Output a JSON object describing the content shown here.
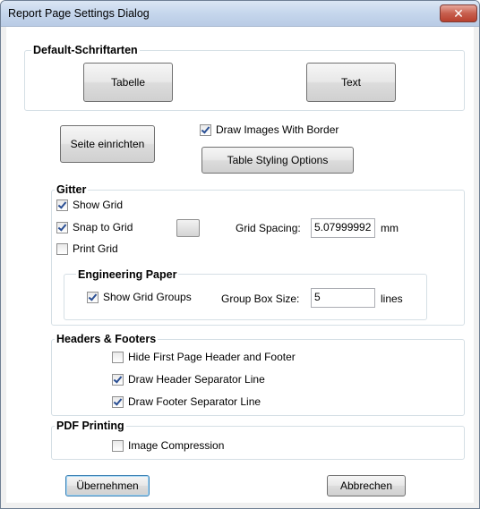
{
  "window": {
    "title": "Report Page Settings Dialog",
    "close_glyph": "✕"
  },
  "default_fonts": {
    "title": "Default-Schriftarten",
    "table_label": "Tabelle",
    "text_label": "Text"
  },
  "page_setup_label": "Seite einrichten",
  "draw_images_border": {
    "label": "Draw Images With Border",
    "checked": true
  },
  "table_styling_label": "Table Styling Options",
  "grid": {
    "title": "Gitter",
    "show_grid": {
      "label": "Show Grid",
      "checked": true
    },
    "snap_to_grid": {
      "label": "Snap to Grid",
      "checked": true
    },
    "print_grid": {
      "label": "Print Grid",
      "checked": false
    },
    "spacing_label": "Grid Spacing:",
    "spacing_value": "5.07999992",
    "spacing_unit": "mm"
  },
  "engineering_paper": {
    "title": "Engineering Paper",
    "show_groups": {
      "label": "Show Grid Groups",
      "checked": true
    },
    "box_size_label": "Group Box Size:",
    "box_size_value": "5",
    "box_size_unit": "lines"
  },
  "headers_footers": {
    "title": "Headers & Footers",
    "hide_first": {
      "label": "Hide First Page Header and Footer",
      "checked": false
    },
    "header_sep": {
      "label": "Draw Header Separator Line",
      "checked": true
    },
    "footer_sep": {
      "label": "Draw Footer Separator Line",
      "checked": true
    }
  },
  "pdf_printing": {
    "title": "PDF Printing",
    "image_compression": {
      "label": "Image Compression",
      "checked": false
    }
  },
  "footer_buttons": {
    "apply_label": "Übernehmen",
    "cancel_label": "Abbrechen"
  }
}
